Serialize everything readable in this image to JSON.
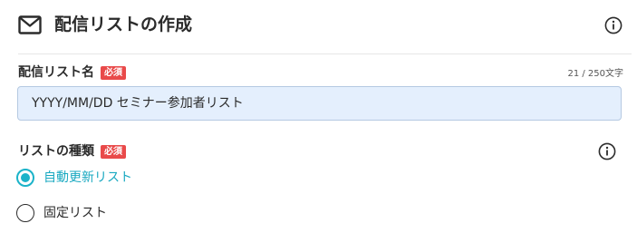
{
  "header": {
    "title": "配信リストの作成",
    "icon": "mail-icon",
    "info_icon": "info-icon"
  },
  "list_name": {
    "label": "配信リスト名",
    "required_badge": "必須",
    "char_count": "21 / 250文字",
    "value": "YYYY/MM/DD セミナー参加者リスト"
  },
  "list_type": {
    "label": "リストの種類",
    "required_badge": "必須",
    "info_icon": "info-icon",
    "options": [
      {
        "label": "自動更新リスト",
        "selected": true
      },
      {
        "label": "固定リスト",
        "selected": false
      }
    ]
  },
  "colors": {
    "accent": "#1bb3c9",
    "required_badge": "#e94a4a",
    "input_background": "#e4effd",
    "input_border": "#b5c9e2",
    "text": "#2b2b2b"
  }
}
